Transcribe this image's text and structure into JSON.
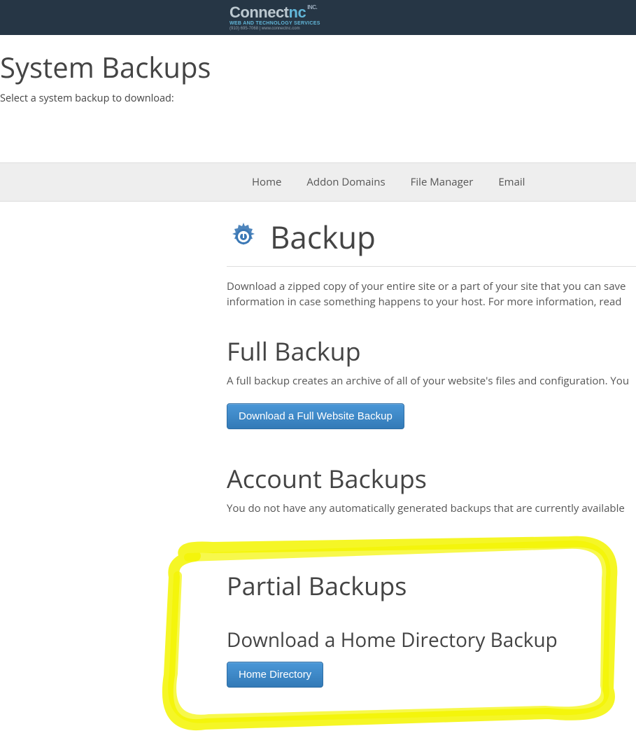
{
  "topbar": {
    "logo_main_left": "Connect",
    "logo_main_right": "nc",
    "logo_inc": "INC.",
    "logo_tag": "WEB AND TECHNOLOGY SERVICES",
    "logo_sub": "(910) 695-7068  |  www.connectnc.com"
  },
  "intro": {
    "title": "System Backups",
    "subtitle": "Select a system backup to download:"
  },
  "nav": {
    "items": [
      "Home",
      "Addon Domains",
      "File Manager",
      "Email"
    ]
  },
  "backup": {
    "icon": "gear-backup-icon",
    "heading": "Backup",
    "description": "Download a zipped copy of your entire site or a part of your site that you can save information in case something happens to your host. For more information, read ",
    "full_title": "Full Backup",
    "full_desc": "A full backup creates an archive of all of your website's files and configuration. You",
    "full_button": "Download a Full Website Backup",
    "account_title": "Account Backups",
    "account_desc": "You do not have any automatically generated backups that are currently available",
    "partial_title": "Partial Backups",
    "home_title": "Download a Home Directory Backup",
    "home_button": "Home Directory"
  }
}
